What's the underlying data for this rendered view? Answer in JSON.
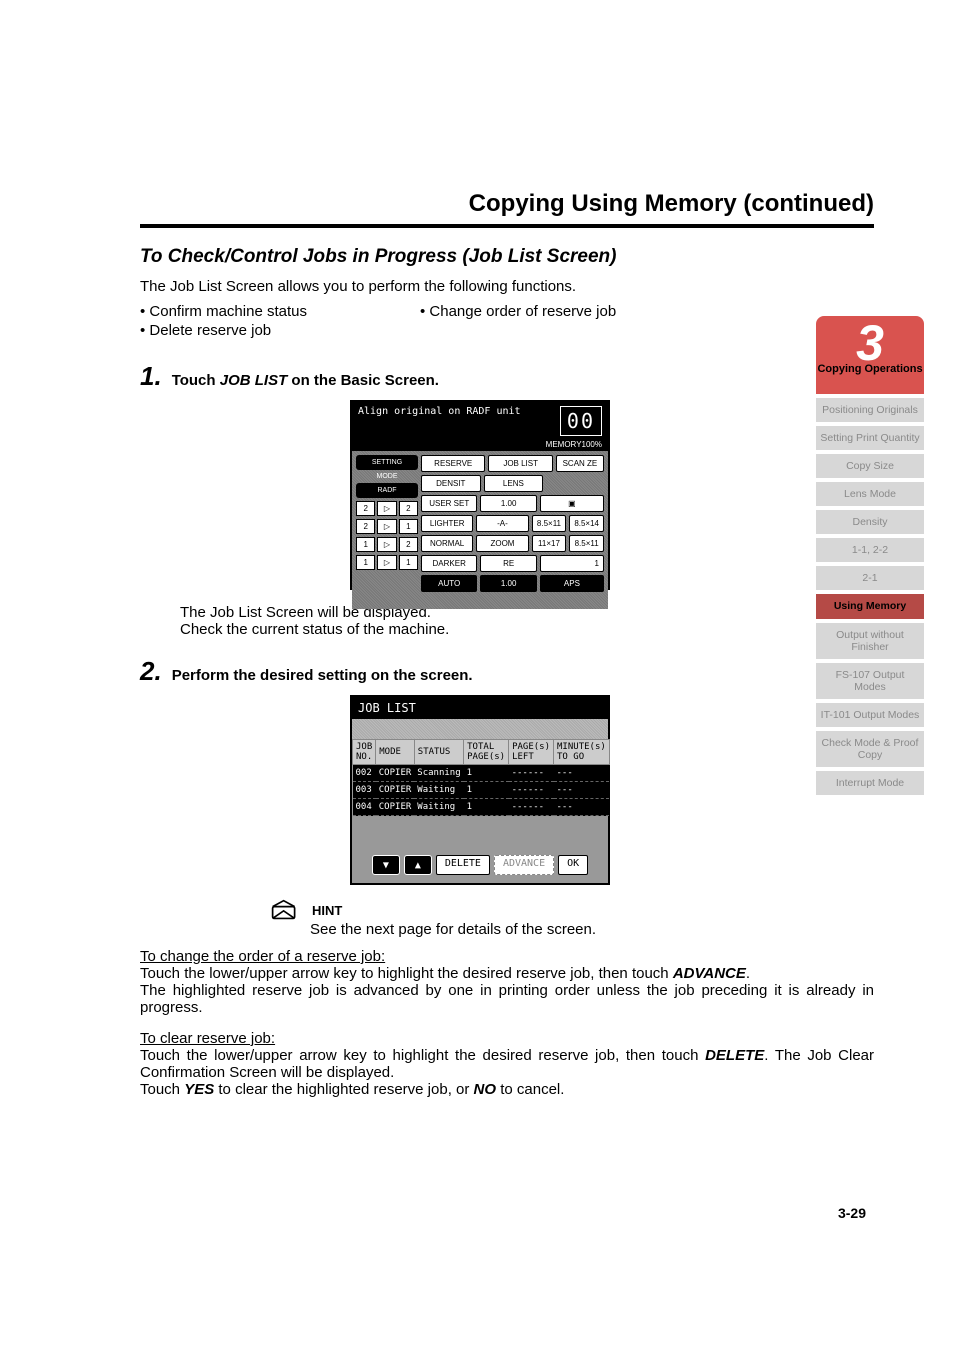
{
  "header": {
    "section_title": "Copying Using Memory (continued)",
    "subtitle": "To Check/Control Jobs in Progress (Job List Screen)",
    "intro": "The Job List Screen allows you to perform the following functions.",
    "bullets": {
      "a": "• Confirm machine status",
      "b": "• Change order of reserve job",
      "c": "• Delete reserve job"
    }
  },
  "step1": {
    "num": "1.",
    "prefix": "Touch ",
    "cmd": "JOB LIST",
    "suffix": " on the Basic Screen.",
    "after1": "The Job List Screen will be displayed.",
    "after2": "Check the current status of the machine."
  },
  "fig1": {
    "topmsg": "Align original on RADF unit",
    "memory": "MEMORY100%",
    "counter": "00",
    "setting": "SETTING",
    "mode": "MODE",
    "radf": "RADF",
    "reserve": "RESERVE",
    "densit": "DENSIT",
    "userset": "USER SET",
    "lighter": "LIGHTER",
    "normal": "NORMAL",
    "darker": "DARKER",
    "auto": "AUTO",
    "joblist": "JOB LIST",
    "lens": "LENS",
    "val100": "1.00",
    "a": "-A-",
    "zoom": "ZOOM",
    "re": "RE",
    "v85x11": "8.5×11",
    "v11x17": "11×17",
    "v85x14": "8.5×14",
    "v85x11b": "8.5×11",
    "scanze": "SCAN ZE",
    "one": "1",
    "aps": "APS"
  },
  "step2": {
    "num": "2.",
    "text": "Perform the desired setting on the screen."
  },
  "fig2": {
    "title": "JOB LIST",
    "h_jobno": "JOB NO.",
    "h_mode": "MODE",
    "h_status": "STATUS",
    "h_total": "TOTAL PAGE(s)",
    "h_left": "PAGE(s) LEFT",
    "h_togo": "MINUTE(s) TO GO",
    "r1": {
      "no": "002",
      "mode": "COPIER",
      "status": "Scanning",
      "total": "1",
      "left": "------",
      "togo": "---"
    },
    "r2": {
      "no": "003",
      "mode": "COPIER",
      "status": "Waiting",
      "total": "1",
      "left": "------",
      "togo": "---"
    },
    "r3": {
      "no": "004",
      "mode": "COPIER",
      "status": "Waiting",
      "total": "1",
      "left": "------",
      "togo": "---"
    },
    "btn_down": "▼",
    "btn_up": "▲",
    "btn_delete": "DELETE",
    "btn_advance": "ADVANCE",
    "btn_ok": "OK"
  },
  "hint": {
    "label": "HINT",
    "text": "See the next page for details of the screen."
  },
  "block1": {
    "head": "To change the order of a reserve job:",
    "l1a": "Touch the lower/upper arrow key to highlight the desired reserve job, then touch ",
    "l1b": "ADVANCE",
    "l1c": ".",
    "l2": "The highlighted reserve job is advanced by one in printing order unless the job preceding it is already in progress."
  },
  "block2": {
    "head": "To clear reserve job:",
    "l1a": "Touch the lower/upper arrow key to highlight the desired reserve job, then touch ",
    "l1b": "DELETE",
    "l1c": ". The Job Clear Confirmation Screen will be displayed.",
    "l2a": "Touch ",
    "l2b": "YES",
    "l2c": " to clear the highlighted reserve job, or ",
    "l2d": "NO",
    "l2e": " to cancel."
  },
  "pagefoot": "3-29",
  "sidenav": {
    "chapter_num": "3",
    "chapter_label": "Copying Operations",
    "items": [
      "Positioning Originals",
      "Setting Print Quantity",
      "Copy Size",
      "Lens Mode",
      "Density",
      "1-1, 2-2",
      "2-1",
      "Using Memory",
      "Output without Finisher",
      "FS-107 Output Modes",
      "IT-101 Output Modes",
      "Check Mode & Proof Copy",
      "Interrupt Mode"
    ],
    "active_index": 7
  }
}
